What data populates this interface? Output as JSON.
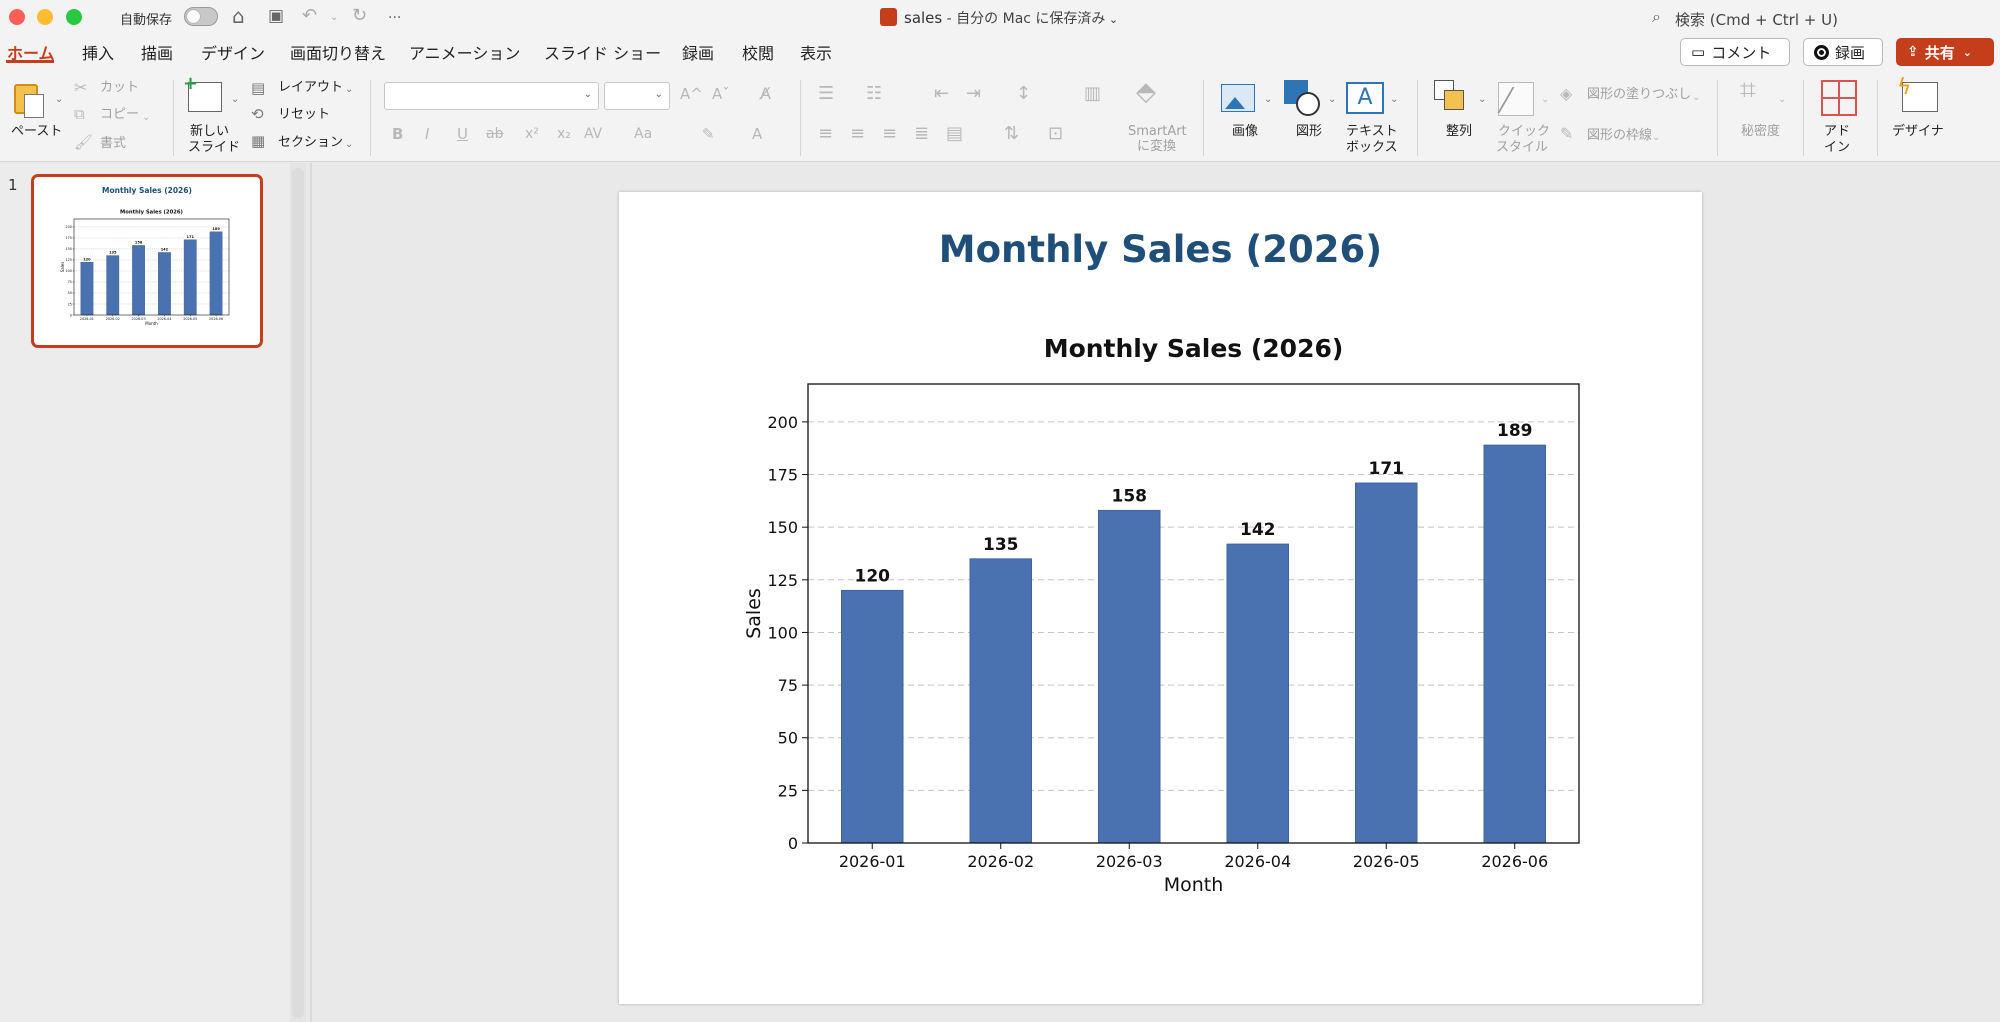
{
  "titlebar": {
    "autosave_label": "自動保存",
    "file_name": "sales",
    "save_status": " - 自分の Mac に保存済み",
    "search_placeholder": "検索 (Cmd + Ctrl + U)",
    "more": "···"
  },
  "tabs": [
    {
      "label": "ホーム",
      "active": true
    },
    {
      "label": "挿入"
    },
    {
      "label": "描画"
    },
    {
      "label": "デザイン"
    },
    {
      "label": "画面切り替え"
    },
    {
      "label": "アニメーション"
    },
    {
      "label": "スライド ショー"
    },
    {
      "label": "録画"
    },
    {
      "label": "校閲"
    },
    {
      "label": "表示"
    }
  ],
  "actions": {
    "comment": "コメント",
    "record": "録画",
    "share": "共有"
  },
  "ribbon": {
    "paste": "ペースト",
    "cut": "カット",
    "copy": "コピー",
    "format": "書式",
    "new_slide_1": "新しい",
    "new_slide_2": "スライド",
    "layout": "レイアウト",
    "reset": "リセット",
    "section": "セクション",
    "smartart_1": "SmartArt",
    "smartart_2": "に変換",
    "picture": "画像",
    "shape": "図形",
    "textbox_1": "テキスト",
    "textbox_2": "ボックス",
    "arrange": "整列",
    "quick_style_1": "クイック",
    "quick_style_2": "スタイル",
    "shape_fill": "図形の塗りつぶし",
    "shape_outline": "図形の枠線",
    "sensitivity": "秘密度",
    "addin_1": "アド",
    "addin_2": "イン",
    "designer": "デザイナ",
    "font_buttons": [
      "B",
      "I",
      "U",
      "ab",
      "x²",
      "x₂",
      "AV",
      "Aa"
    ],
    "font_grow": "A^",
    "font_shrink": "Aˇ"
  },
  "thumbnail": {
    "number": "1",
    "title": "Monthly Sales (2026)",
    "chart_title": "Monthly Sales (2026)",
    "ylabel": "Sales",
    "xlabel": "Month"
  },
  "slide": {
    "title": "Monthly Sales (2026)"
  },
  "colors": {
    "accent": "#c43e1c",
    "bar": "#4a72b0",
    "title": "#1f4e79"
  },
  "chart_data": {
    "type": "bar",
    "title": "Monthly Sales (2026)",
    "xlabel": "Month",
    "ylabel": "Sales",
    "categories": [
      "2026-01",
      "2026-02",
      "2026-03",
      "2026-04",
      "2026-05",
      "2026-06"
    ],
    "values": [
      120,
      135,
      158,
      142,
      171,
      189
    ],
    "ylim": [
      0,
      218
    ],
    "yticks": [
      0,
      25,
      50,
      75,
      100,
      125,
      150,
      175,
      200
    ],
    "grid": "y-dashed",
    "data_labels": true
  }
}
